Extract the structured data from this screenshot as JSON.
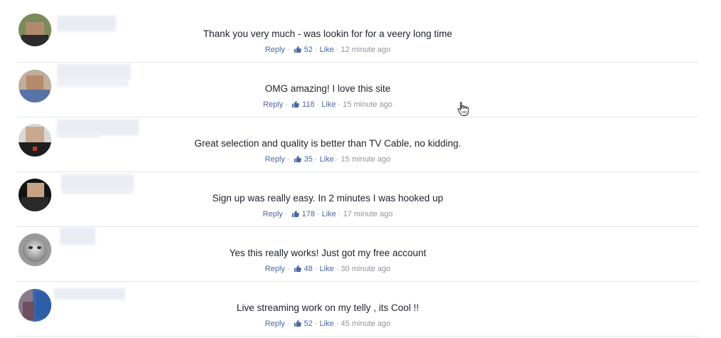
{
  "comments": [
    {
      "text": "Thank you very much - was lookin for for a veery long time",
      "reply": "Reply",
      "likes": "52",
      "like": "Like",
      "time": "12 minute ago"
    },
    {
      "text": "OMG amazing! I love this site",
      "reply": "Reply",
      "likes": "118",
      "like": "Like",
      "time": "15 minute ago"
    },
    {
      "text": "Great selection and quality is better than TV Cable, no kidding.",
      "reply": "Reply",
      "likes": "35",
      "like": "Like",
      "time": "15 minute ago"
    },
    {
      "text": "Sign up was really easy. In 2 minutes I was hooked up",
      "reply": "Reply",
      "likes": "178",
      "like": "Like",
      "time": "17 minute ago"
    },
    {
      "text": "Yes this really works! Just got my free account",
      "reply": "Reply",
      "likes": "48",
      "like": "Like",
      "time": "30 minute ago"
    },
    {
      "text": "Live streaming work on my telly , its Cool !!",
      "reply": "Reply",
      "likes": "52",
      "like": "Like",
      "time": "45 minute ago"
    }
  ],
  "separator": "·",
  "icons": {
    "like": "thumbs-up-icon",
    "cursor": "hand-pointer-icon"
  },
  "colors": {
    "link": "#4b67a1",
    "text": "#1d2129",
    "meta": "#90949c",
    "divider": "#e3e5ea"
  }
}
